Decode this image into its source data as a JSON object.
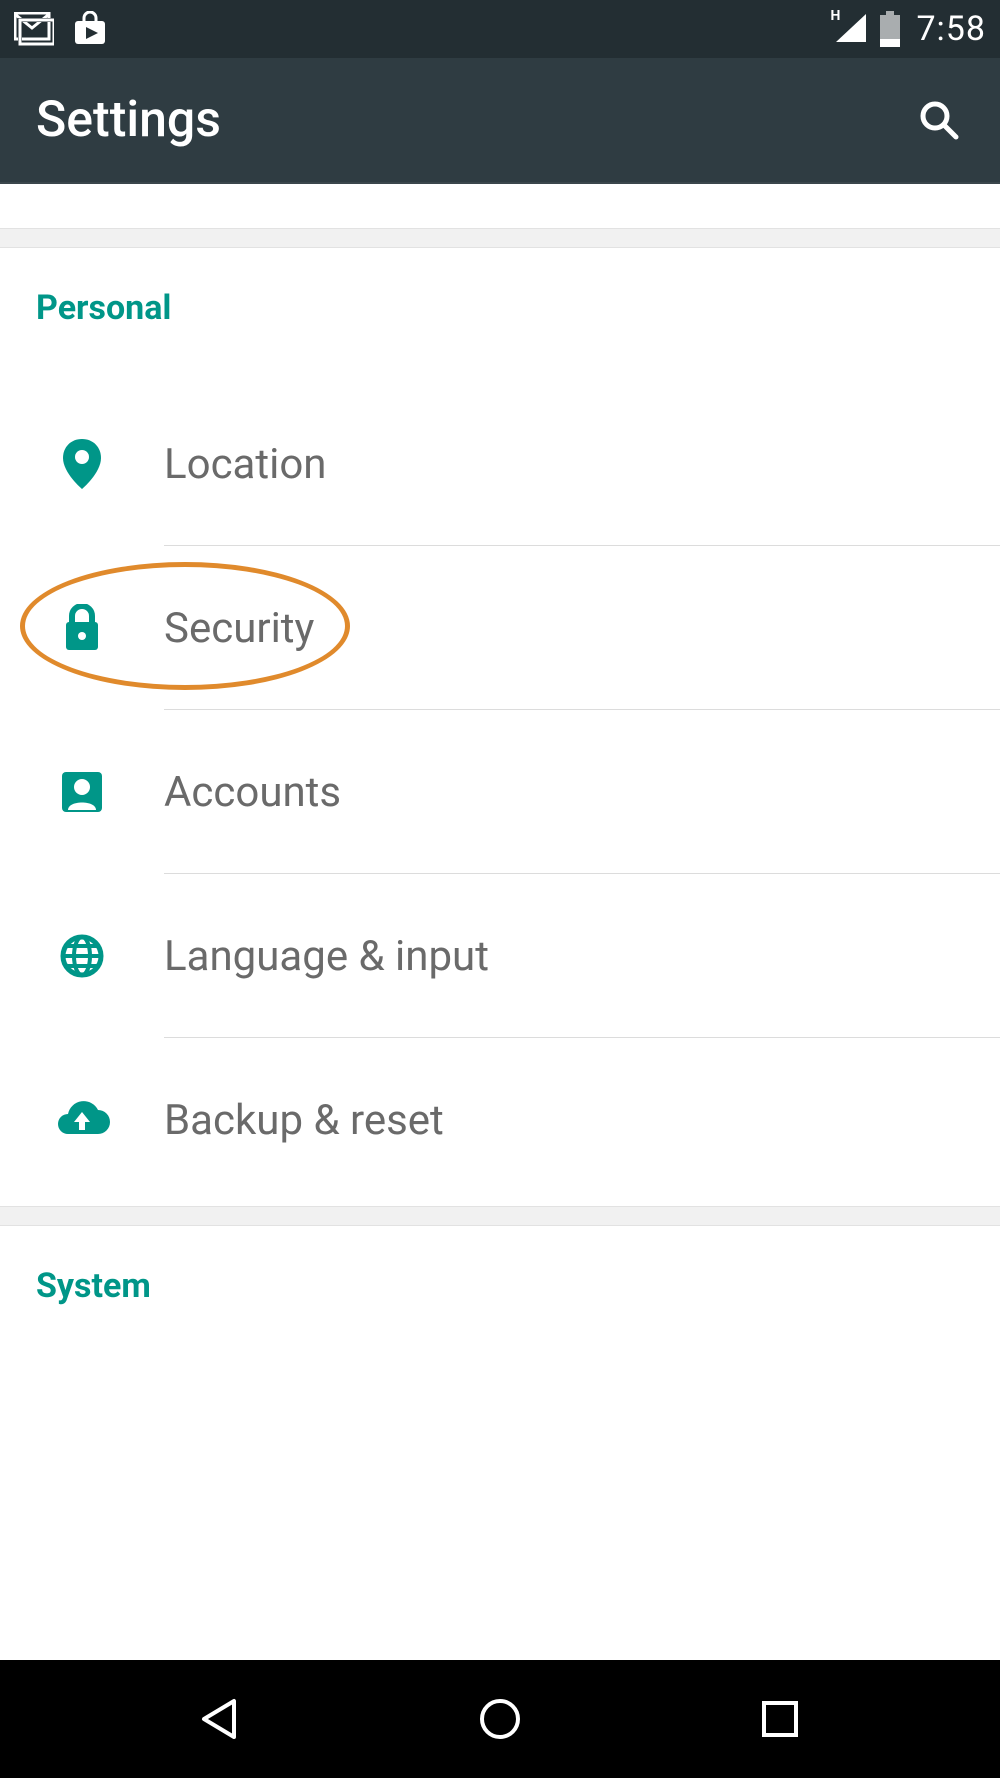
{
  "status": {
    "time": "7:58",
    "network_indicator": "H"
  },
  "appbar": {
    "title": "Settings"
  },
  "sections": {
    "personal": {
      "header": "Personal",
      "items": [
        {
          "label": "Location"
        },
        {
          "label": "Security"
        },
        {
          "label": "Accounts"
        },
        {
          "label": "Language & input"
        },
        {
          "label": "Backup & reset"
        }
      ]
    },
    "system": {
      "header": "System"
    }
  },
  "colors": {
    "accent": "#009688",
    "highlight": "#e08a2c",
    "text_muted": "#6a6a6a"
  }
}
